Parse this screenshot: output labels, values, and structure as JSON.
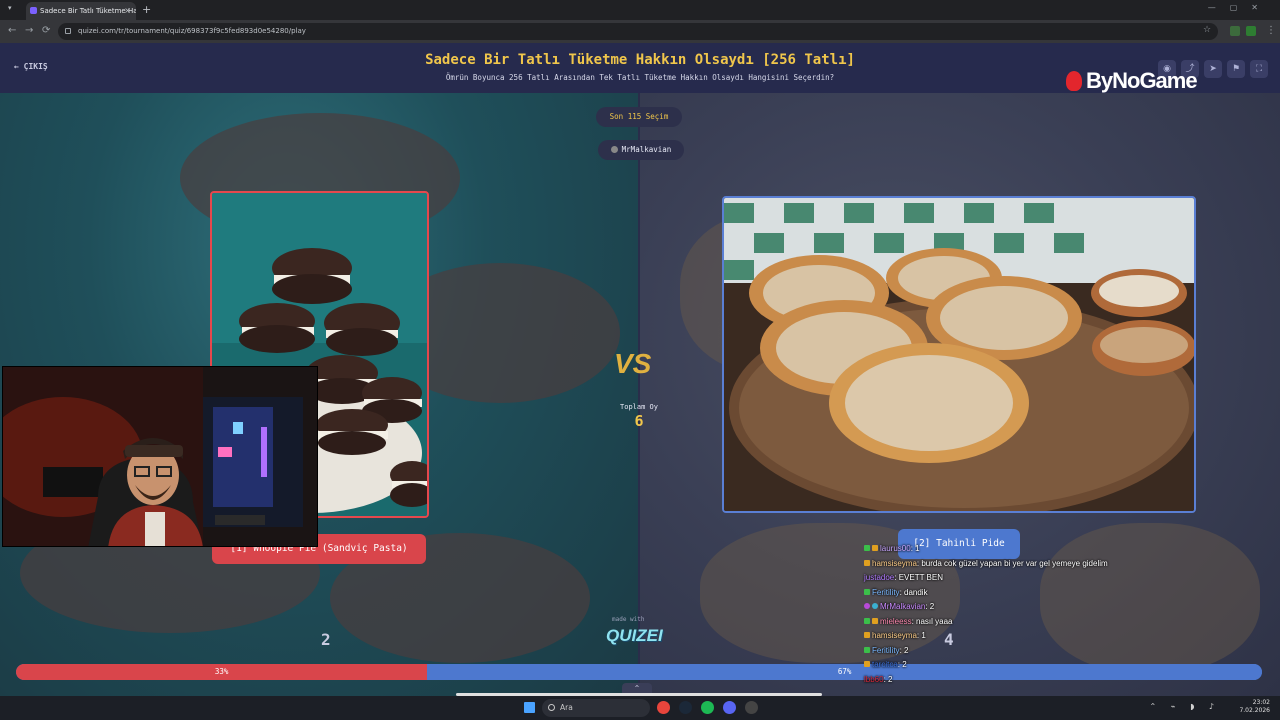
{
  "browser": {
    "tab_title": "Sadece Bir Tatlı Tüketme Hakkı",
    "tab_close": "×",
    "new_tab": "+",
    "url": "quizei.com/tr/tournament/quiz/698373f9c5fed893d0e54280/play",
    "back": "←",
    "forward": "→",
    "reload": "⟳"
  },
  "header": {
    "back_label": "← ÇIKIŞ",
    "title": "Sadece Bir Tatlı Tüketme Hakkın Olsaydı [256 Tatlı]",
    "subtitle": "Ömrün Boyunca 256 Tatlı Arasından Tek Tatlı Tüketme Hakkın Olsaydı Hangisini Seçerdin?",
    "icons": [
      "eye-icon",
      "share-icon",
      "send-icon",
      "flag-icon",
      "fullscreen-icon"
    ]
  },
  "overlay_logo": "ByNoGame",
  "match": {
    "rounds_label": "Son 115 Seçim",
    "creator": "MrMalkavian",
    "vs_label": "VS",
    "total_votes_label": "Toplam Oy",
    "total_votes": "6",
    "left": {
      "label": "[1] Whoopie Pie (Sandviç Pasta)",
      "votes": "2",
      "percent_label": "33%",
      "percent": 33
    },
    "right": {
      "label": "[2] Tahinli Pide",
      "votes": "4",
      "percent_label": "67%",
      "percent": 67
    },
    "made_with": "made with",
    "brand": "QUIZEI"
  },
  "colors": {
    "accent_gold": "#f0c64b",
    "left_red": "#d9454b",
    "right_blue": "#4d78cf"
  },
  "chat": [
    {
      "user": "laurus00",
      "msg": ": 1",
      "color": "#c9a7ff",
      "badges": [
        "g",
        "y"
      ]
    },
    {
      "user": "hamsiseyma",
      "msg": ": burda cok güzel yapan bi yer var gel yemeye gidelim",
      "color": "#ffcf8a",
      "badges": [
        "y"
      ]
    },
    {
      "user": "justadoe",
      "msg": ": EVETT BEN",
      "color": "#b07aff",
      "badges": []
    },
    {
      "user": "Feritility",
      "msg": ": dandik",
      "color": "#7ab8ff",
      "badges": [
        "g"
      ]
    },
    {
      "user": "MrMalkavian",
      "msg": ": 2",
      "color": "#c98aff",
      "badges": [
        "p",
        "c"
      ]
    },
    {
      "user": "mieleess",
      "msg": ": nasıl yaaa",
      "color": "#ff8ab0",
      "badges": [
        "g",
        "y"
      ]
    },
    {
      "user": "hamsiseyma",
      "msg": ": 1",
      "color": "#ffcf8a",
      "badges": [
        "y"
      ]
    },
    {
      "user": "Feritility",
      "msg": ": 2",
      "color": "#7ab8ff",
      "badges": [
        "g"
      ]
    },
    {
      "user": "tarcitca",
      "msg": ": 2",
      "color": "#3a6fd8",
      "badges": [
        "y"
      ]
    },
    {
      "user": "lbb60",
      "msg": ": 2",
      "color": "#d8283a",
      "badges": []
    }
  ],
  "taskbar": {
    "search_placeholder": "Ara",
    "time": "23:02",
    "date": "7.02.2026"
  }
}
